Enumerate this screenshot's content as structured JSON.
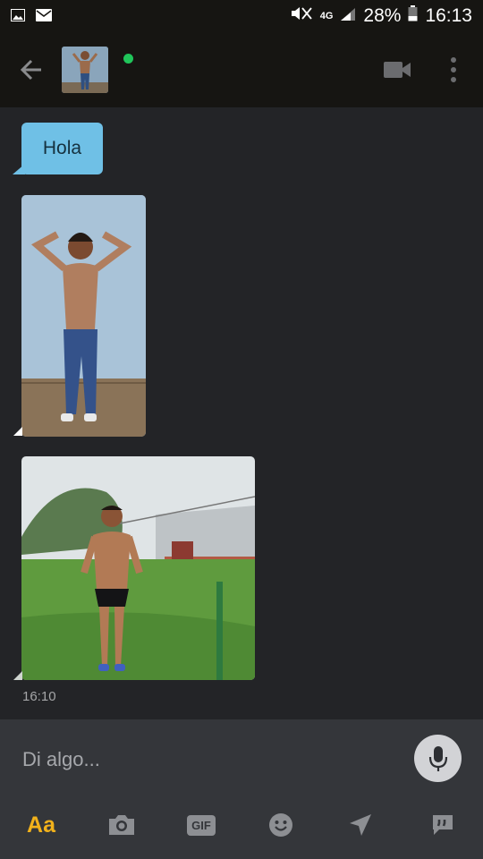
{
  "status_bar": {
    "network": "4G",
    "battery": "28%",
    "time": "16:13"
  },
  "header": {
    "contact_photo": "avatar",
    "online": true
  },
  "messages": [
    {
      "type": "text",
      "text": "Hola"
    },
    {
      "type": "photo"
    },
    {
      "type": "photo"
    }
  ],
  "timestamp": "16:10",
  "input": {
    "placeholder": "Di algo..."
  },
  "toolbar": {
    "text_format_label": "Aa",
    "gif_label": "GIF",
    "icons": [
      "camera-icon",
      "gif-icon",
      "smiley-icon",
      "location-icon",
      "quick-reply-icon"
    ]
  },
  "colors": {
    "bubble": "#6fc0e6",
    "accent": "#f2b21b",
    "online": "#20c55a",
    "background": "#232427"
  }
}
